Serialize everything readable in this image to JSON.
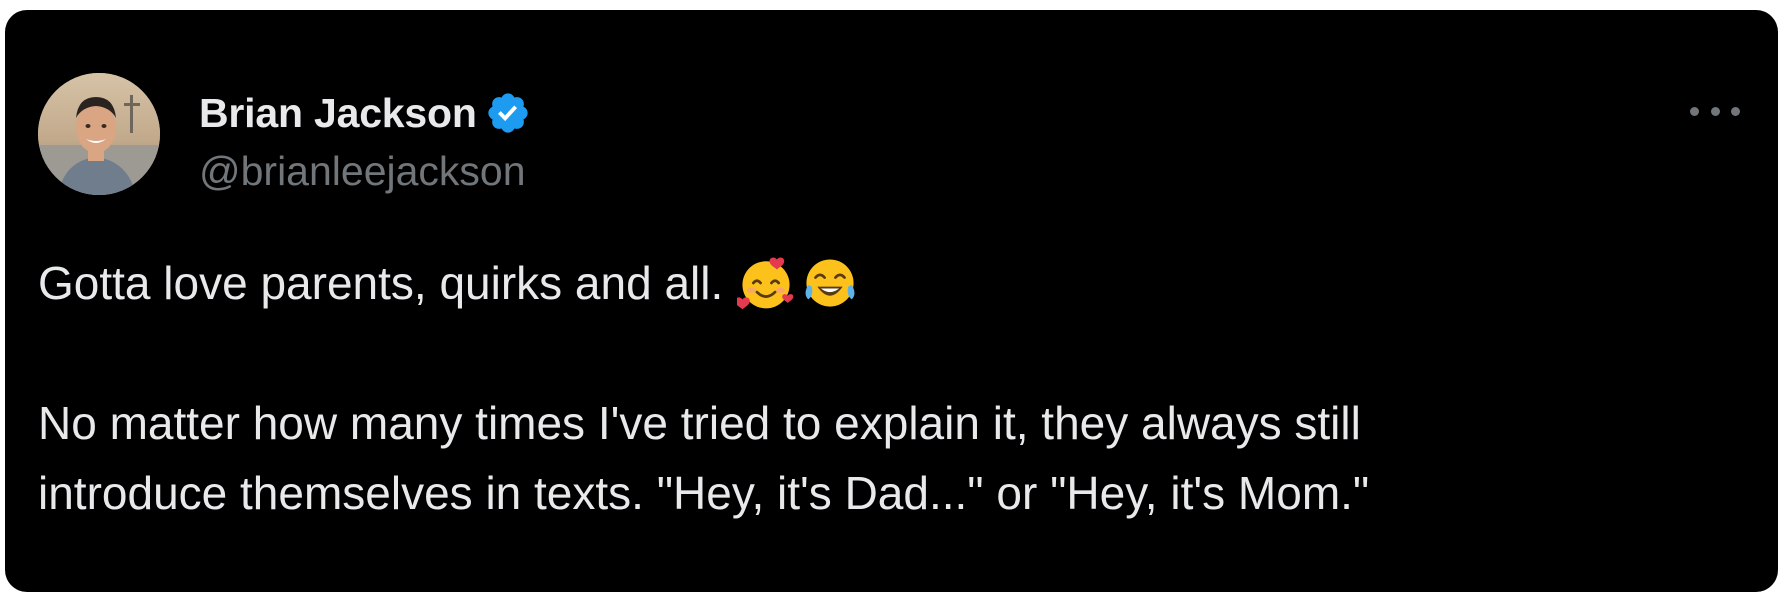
{
  "author": {
    "display_name": "Brian Jackson",
    "handle": "@brianleejackson",
    "verified_icon": "verified-badge-icon",
    "avatar": "profile-photo"
  },
  "tweet": {
    "line1": "Gotta love parents, quirks and all.",
    "line1_emojis": [
      "smiling-face-with-hearts-emoji",
      "face-with-tears-of-joy-emoji"
    ],
    "line2": "No matter how many times I've tried to explain it, they always still",
    "line3": "introduce themselves in texts. \"Hey, it's Dad...\" or \"Hey, it's Mom.\""
  },
  "menu": {
    "icon": "more-options-icon"
  },
  "colors": {
    "background": "#000000",
    "primary_text": "#e7e9ea",
    "secondary_text": "#71767b",
    "verified_blue": "#1d9bf0"
  }
}
